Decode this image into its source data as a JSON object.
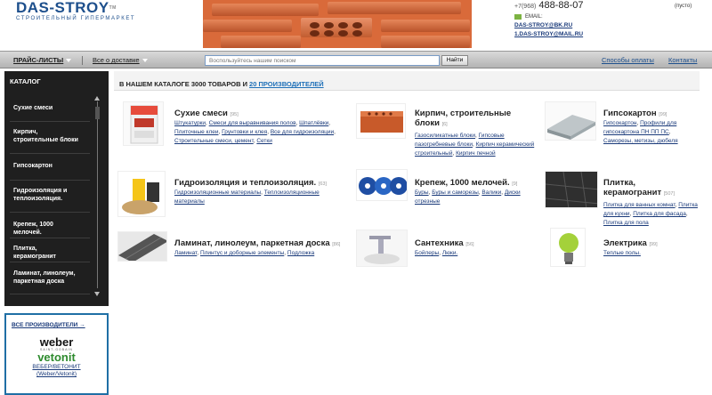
{
  "header": {
    "logo_title": "DAS-STROY",
    "logo_tm": "TM",
    "logo_subtitle": "СТРОИТЕЛЬНЫЙ ГИПЕРМАРКЕТ",
    "phone_code": "+7(968)",
    "phone_number": "488-88-07",
    "cart_status": "(пусто)",
    "email_label": "EMAIL:",
    "emails": [
      "DAS-STROY@BK.RU",
      "1.DAS-STROY@MAIL.RU"
    ]
  },
  "nav": {
    "price_lists": "ПРАЙС-ЛИСТЫ",
    "delivery": "Все о доставке",
    "search_placeholder": "Воспользуйтесь нашим поиском",
    "search_button": "Найти",
    "payment": "Способы оплаты",
    "contacts": "Контакты"
  },
  "sidebar": {
    "title": "КАТАЛОГ",
    "items": [
      "Сухие смеси",
      "Кирпич, строительные блоки",
      "Гипсокартон",
      "Гидроизоляция и теплоизоляция.",
      "Крепеж, 1000 мелочей.",
      "Плитка, керамогранит",
      "Ламинат, линолеум, паркетная доска"
    ],
    "producers_link": "ВСЕ ПРОИЗВОДИТЕЛИ →",
    "producer_logo_1": "weber",
    "producer_logo_1_tag": "SAINT-GOBAIN",
    "producer_logo_2": "vetonit",
    "producer_name_1": "ВЕБЕР/ВЕТОНИТ",
    "producer_name_2": "(Weber/Vetonit)"
  },
  "main": {
    "catalog_head_text": "В НАШЕМ КАТАЛОГЕ 3000 ТОВАРОВ И ",
    "catalog_head_link": "20 ПРОИЗВОДИТЕЛЕЙ",
    "categories": [
      {
        "title": "Сухие смеси",
        "count": "[95]",
        "links": [
          "Штукатурки",
          "Смеси для выравнивания полов",
          "Шпатлёвки",
          "Плиточные клеи",
          "Грунтовки и клея",
          "Все для гидроизоляции",
          "Строительные смеси, цемент",
          "Сетки"
        ]
      },
      {
        "title_line1": "Кирпич, строительные",
        "title_line2": "блоки",
        "count": "[6]",
        "links": [
          "Газосиликатные блоки",
          "Гипсовые пазогребневые блоки",
          "Кирпич керамический строительный",
          "Кирпич печной"
        ]
      },
      {
        "title": "Гипсокартон",
        "count": "[99]",
        "links": [
          "Гипсокартон",
          "Профили для гипсокартона ПН ПП ПС",
          "Саморезы, метизы, дюбеля"
        ]
      },
      {
        "title": "Гидроизоляция и теплоизоляция.",
        "count": "[63]",
        "links": [
          "Гидроизоляционные материалы",
          "Теплоизоляционные материалы"
        ]
      },
      {
        "title": "Крепеж, 1000 мелочей.",
        "count": "[9]",
        "links": [
          "Буры",
          "Буры и саморезы",
          "Валики",
          "Диски отрезные"
        ]
      },
      {
        "title_line1": "Плитка,",
        "title_line2": "керамогранит",
        "count": "[507]",
        "links": [
          "Плитка для ванных комнат",
          "Плитка для кухни",
          "Плитка для фасада",
          "Плитка для пола"
        ]
      },
      {
        "title": "Ламинат, линолеум, паркетная доска",
        "count": "[86]",
        "links": [
          "Ламинат",
          "Плинтус и доборные элементы",
          "Подложка"
        ]
      },
      {
        "title": "Сантехника",
        "count": "[56]",
        "links": [
          "Бойлеры",
          "Люки."
        ]
      },
      {
        "title": "Электрика",
        "count": "[99]",
        "links": [
          "Теплые полы."
        ]
      }
    ]
  }
}
